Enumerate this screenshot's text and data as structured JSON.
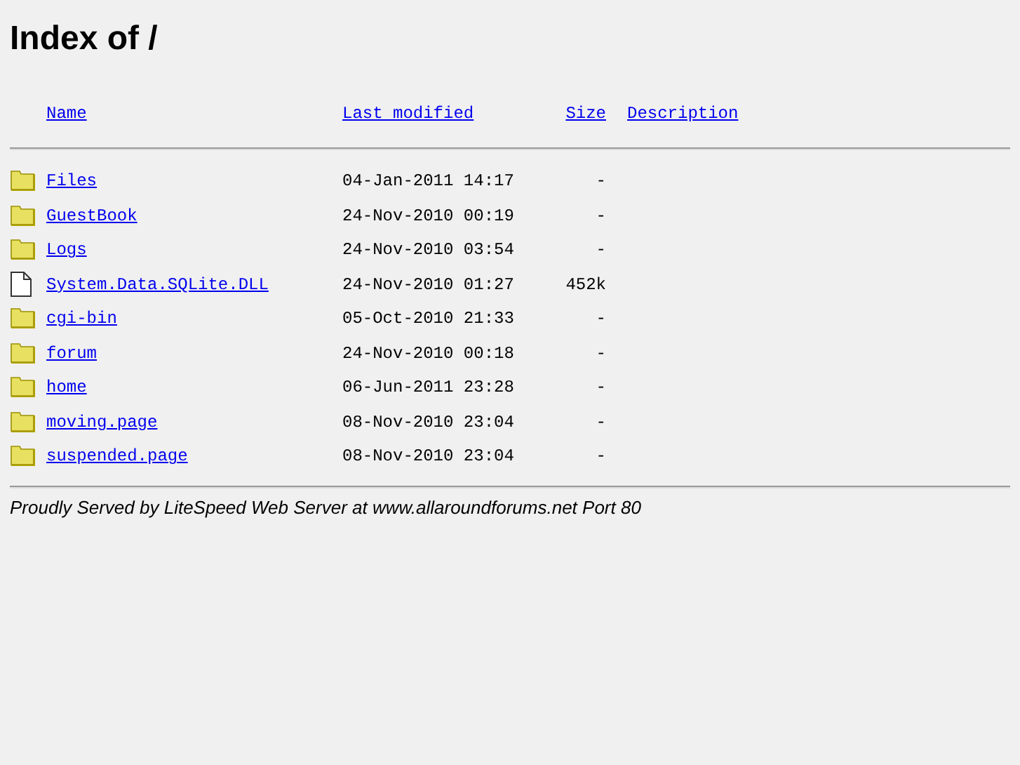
{
  "title": "Index of /",
  "columns": [
    "Name",
    "Last modified",
    "Size",
    "Description"
  ],
  "rows": [
    {
      "kind": "folder",
      "name": "Files",
      "modified": "04-Jan-2011 14:17",
      "size": "-"
    },
    {
      "kind": "folder",
      "name": "GuestBook",
      "modified": "24-Nov-2010 00:19",
      "size": "-"
    },
    {
      "kind": "folder",
      "name": "Logs",
      "modified": "24-Nov-2010 03:54",
      "size": "-"
    },
    {
      "kind": "file",
      "name": "System.Data.SQLite.DLL",
      "modified": "24-Nov-2010 01:27",
      "size": "452k"
    },
    {
      "kind": "folder",
      "name": "cgi-bin",
      "modified": "05-Oct-2010 21:33",
      "size": "-"
    },
    {
      "kind": "folder",
      "name": "forum",
      "modified": "24-Nov-2010 00:18",
      "size": "-"
    },
    {
      "kind": "folder",
      "name": "home",
      "modified": "06-Jun-2011 23:28",
      "size": "-"
    },
    {
      "kind": "folder",
      "name": "moving.page",
      "modified": "08-Nov-2010 23:04",
      "size": "-"
    },
    {
      "kind": "folder",
      "name": "suspended.page",
      "modified": "08-Nov-2010 23:04",
      "size": "-"
    }
  ],
  "footer": "Proudly Served by LiteSpeed Web Server at www.allaroundforums.net Port 80"
}
